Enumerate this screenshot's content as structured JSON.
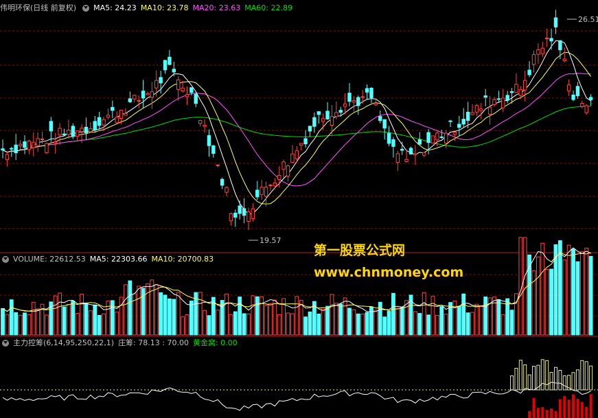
{
  "colors": {
    "background": "#000000",
    "up": "#ff4444",
    "down": "#54ffff",
    "ma5": "#ffffff",
    "ma10": "#ffff54",
    "ma20": "#ff54ff",
    "ma60": "#00e000",
    "grid": "#7a1414",
    "text": "#c0c0c0",
    "watermark": "#ffd700"
  },
  "price_panel": {
    "stock_title": "伟明环保(日线 前复权)",
    "ma5": "MA5: 24.23",
    "ma10": "MA10: 23.78",
    "ma20": "MA20: 23.63",
    "ma60": "MA60: 22.89",
    "high_label": "26.51",
    "low_label": "19.57"
  },
  "volume_panel": {
    "volume": "VOLUME: 22612.53",
    "ma5": "MA5: 22303.66",
    "ma10": "MA10: 20700.83"
  },
  "indicator_panel": {
    "name": "主力控筹(6,14,95,250,22,1)",
    "zhuangchou": "庄筹: 78.13 : 70.00",
    "golden": "黄金窝: 0.00"
  },
  "watermark": {
    "line1": "第一股票公式网",
    "line2": "www.chnmoney.com"
  }
}
